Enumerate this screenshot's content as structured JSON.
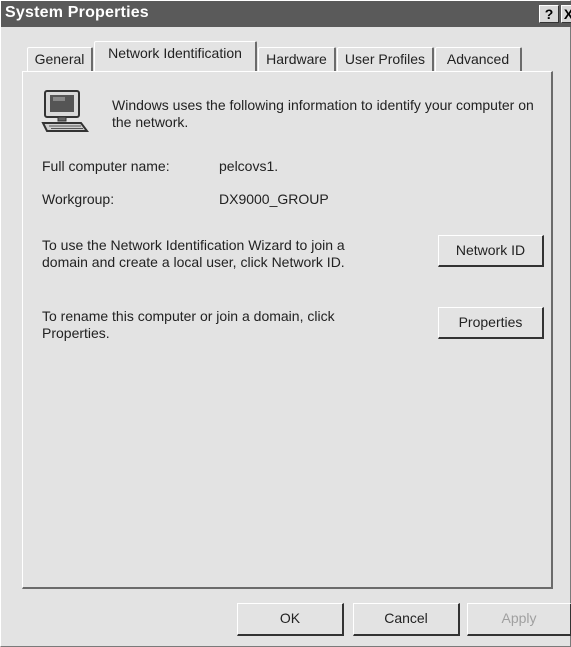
{
  "window": {
    "title": "System Properties"
  },
  "titlebar": {
    "help_label": "?",
    "close_label": "X"
  },
  "tabs": [
    {
      "label": "General"
    },
    {
      "label": "Network Identification"
    },
    {
      "label": "Hardware"
    },
    {
      "label": "User Profiles"
    },
    {
      "label": "Advanced"
    }
  ],
  "panel": {
    "icon": "computer-icon",
    "intro_text": "Windows uses the following information to identify your computer on the network.",
    "full_name_label": "Full computer name:",
    "full_name_value": "pelcovs1.",
    "workgroup_label": "Workgroup:",
    "workgroup_value": "DX9000_GROUP",
    "wizard_text": "To use the Network Identification Wizard to join a domain and create a local user, click Network ID.",
    "network_id_button": "Network ID",
    "rename_text": "To rename this computer or join a domain, click Properties.",
    "properties_button": "Properties"
  },
  "footer": {
    "ok": "OK",
    "cancel": "Cancel",
    "apply": "Apply"
  },
  "colors": {
    "titlebar": "#5a5a5a",
    "face": "#e3e3e3",
    "shadow": "#6b6b6b"
  }
}
